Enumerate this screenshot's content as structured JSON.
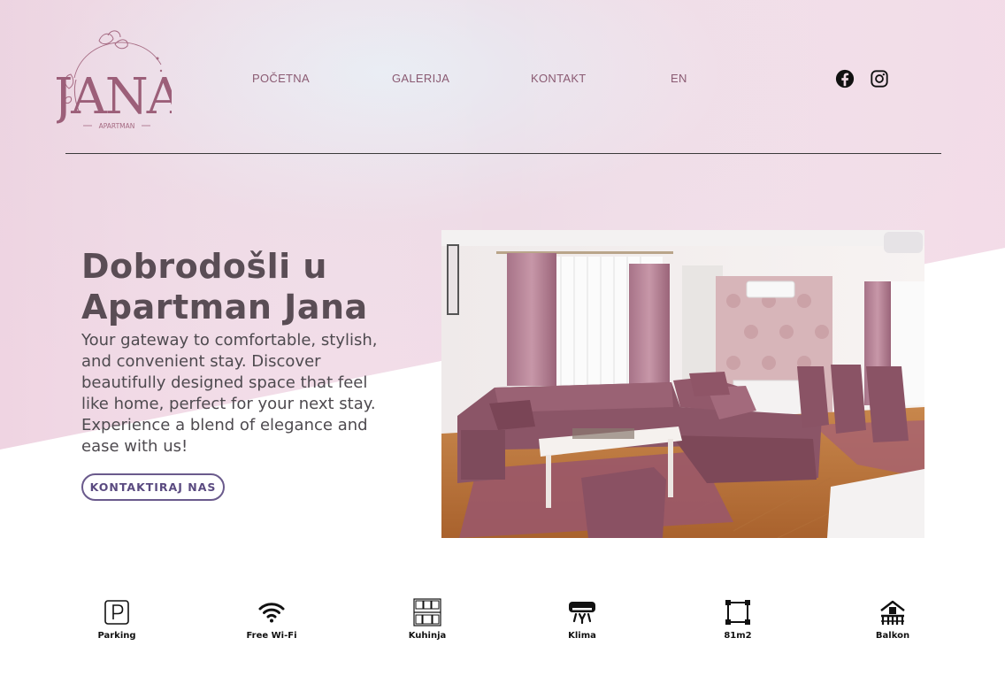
{
  "brand": {
    "logo_name": "JANA",
    "logo_sub": "APARTMAN"
  },
  "nav": {
    "items": [
      {
        "label": "POČETNA"
      },
      {
        "label": "GALERIJA"
      },
      {
        "label": "KONTAKT"
      },
      {
        "label": "EN"
      }
    ],
    "social": [
      "facebook-icon",
      "instagram-icon"
    ]
  },
  "hero": {
    "title_line1": "Dobrodošli u",
    "title_line2": "Apartman Jana",
    "description": "Your gateway to comfortable, stylish, and convenient stay. Discover beautifully designed space that feel like home, perfect for your next stay. Experience a blend of elegance and ease with us!",
    "cta_label": "KONTAKTIRAJ NAS"
  },
  "amenities": [
    {
      "label": "Parking",
      "icon": "parking-icon"
    },
    {
      "label": "Free Wi-Fi",
      "icon": "wifi-icon"
    },
    {
      "label": "Kuhinja",
      "icon": "kitchen-icon"
    },
    {
      "label": "Klima",
      "icon": "air-conditioner-icon"
    },
    {
      "label": "81m2",
      "icon": "area-icon"
    },
    {
      "label": "Balkon",
      "icon": "balcony-icon"
    }
  ],
  "colors": {
    "accent": "#8a5a72",
    "heading": "#5a4d55",
    "cta_border": "#6a5a8c",
    "background_pink": "#f1d7e3"
  }
}
